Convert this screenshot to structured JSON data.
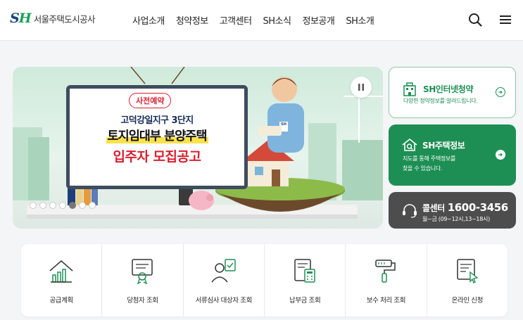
{
  "header": {
    "logo_mark_s": "S",
    "logo_mark_h": "H",
    "logo_text": "서울주택도시공사",
    "nav": [
      "사업소개",
      "청약정보",
      "고객센터",
      "SH소식",
      "정보공개",
      "SH소개"
    ],
    "search_icon": "search-icon",
    "menu_icon": "hamburger-menu-icon"
  },
  "banner": {
    "tag": "사전예약",
    "line1": "고덕강일지구 3단지",
    "line2": "토지임대부 분양주택",
    "line3": "입주자 모집공고",
    "badge": "SH",
    "slide_count": 7,
    "active_slide": 5
  },
  "side_cards": [
    {
      "title": "SH인터넷청약",
      "desc": [
        "다양한 청약정보를 알려드립니다."
      ],
      "icon": "building-icon"
    },
    {
      "title": "SH주택정보",
      "desc": [
        "지도를 통해 주택정보를",
        "찾을 수 있습니다."
      ],
      "icon": "house-search-icon"
    },
    {
      "title": "콜센터",
      "phone": "1600-3456",
      "hours": "월~금 (09~12시,13~18시)",
      "icon": "headset-icon"
    }
  ],
  "quick_menu": [
    {
      "label": "공급계획",
      "icon": "chart-house-icon"
    },
    {
      "label": "당첨자 조회",
      "icon": "certificate-icon"
    },
    {
      "label": "서류심사 대상자 조회",
      "icon": "user-document-icon"
    },
    {
      "label": "납부금 조회",
      "icon": "calculator-document-icon"
    },
    {
      "label": "보수 처리 조회",
      "icon": "paint-roller-icon"
    },
    {
      "label": "온라인 신청",
      "icon": "online-apply-icon"
    }
  ],
  "colors": {
    "brand_green": "#1e8f54",
    "brand_navy": "#1e3f7a",
    "accent_red": "#d92030",
    "call_dark": "#4d4d4d"
  }
}
